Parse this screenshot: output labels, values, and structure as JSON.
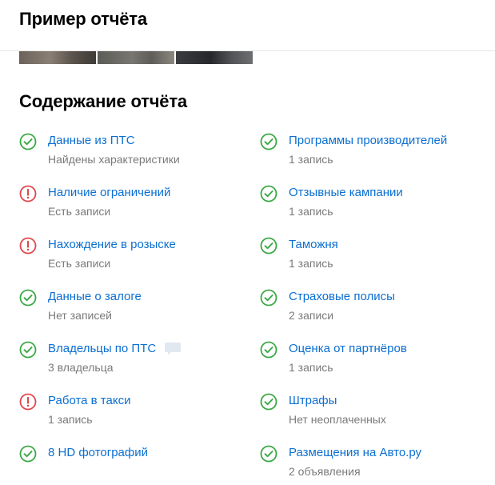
{
  "header": {
    "title": "Пример отчёта"
  },
  "thumbnails": [
    "photo-1",
    "photo-2",
    "photo-3"
  ],
  "section": {
    "title": "Содержание отчёта"
  },
  "colors": {
    "ok": "#3aa843",
    "warning": "#e0464b",
    "link": "#0b6fd1",
    "muted": "#7a7a7a"
  },
  "left_items": [
    {
      "title": "Данные из ПТС",
      "sub": "Найдены характеристики",
      "status": "ok"
    },
    {
      "title": "Наличие ограничений",
      "sub": "Есть записи",
      "status": "warning"
    },
    {
      "title": "Нахождение в розыске",
      "sub": "Есть записи",
      "status": "warning"
    },
    {
      "title": "Данные о залоге",
      "sub": "Нет записей",
      "status": "ok"
    },
    {
      "title": "Владельцы по ПТС",
      "sub": "3 владельца",
      "status": "ok",
      "badge": "comment-icon"
    },
    {
      "title": "Работа в такси",
      "sub": "1 запись",
      "status": "warning"
    },
    {
      "title": "8 HD фотографий",
      "sub": "",
      "status": "ok"
    }
  ],
  "right_items": [
    {
      "title": "Программы производителей",
      "sub": "1 запись",
      "status": "ok"
    },
    {
      "title": "Отзывные кампании",
      "sub": "1 запись",
      "status": "ok"
    },
    {
      "title": "Таможня",
      "sub": "1 запись",
      "status": "ok"
    },
    {
      "title": "Страховые полисы",
      "sub": "2 записи",
      "status": "ok"
    },
    {
      "title": "Оценка от партнёров",
      "sub": "1 запись",
      "status": "ok"
    },
    {
      "title": "Штрафы",
      "sub": "Нет неоплаченных",
      "status": "ok"
    },
    {
      "title": "Размещения на Авто.ру",
      "sub": "2 объявления",
      "status": "ok"
    }
  ]
}
